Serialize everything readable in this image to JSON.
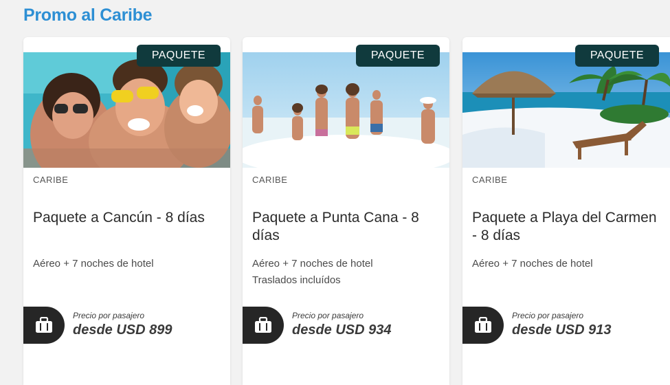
{
  "section": {
    "title": "Promo al Caribe"
  },
  "colors": {
    "accent": "#2d8fd4",
    "badge": "#103a3d",
    "price_tab": "#262626"
  },
  "cards": [
    {
      "badge": "PAQUETE",
      "region": "CARIBE",
      "title": "Paquete a Cancún - 8 días",
      "features": [
        "Aéreo + 7 noches de hotel",
        ""
      ],
      "price_label": "Precio por pasajero",
      "price": "desde USD 899",
      "image": "friends-selfie-pool",
      "icon": "suitcase-icon"
    },
    {
      "badge": "PAQUETE",
      "region": "CARIBE",
      "title": "Paquete a Punta Cana - 8 días",
      "features": [
        "Aéreo + 7 noches de hotel",
        "Traslados incluídos"
      ],
      "price_label": "Precio por pasajero",
      "price": "desde USD 934",
      "image": "people-running-into-sea",
      "icon": "suitcase-icon"
    },
    {
      "badge": "PAQUETE",
      "region": "CARIBE",
      "title": "Paquete a Playa del Carmen - 8 días",
      "features": [
        "Aéreo + 7 noches de hotel",
        ""
      ],
      "price_label": "Precio por pasajero",
      "price": "desde USD 913",
      "image": "beach-umbrella-palms",
      "icon": "suitcase-icon"
    }
  ]
}
